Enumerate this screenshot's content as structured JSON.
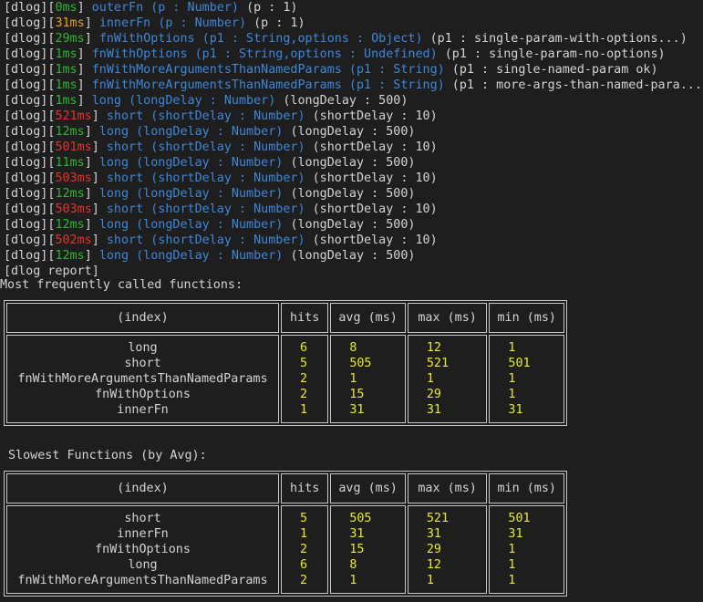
{
  "log_prefix": "[dlog]",
  "log_lines": [
    {
      "time": "0ms",
      "time_color": "green",
      "fn": "outerFn",
      "sig": "(p : Number)",
      "args": "(p : 1)"
    },
    {
      "time": "31ms",
      "time_color": "orange",
      "fn": "innerFn",
      "sig": "(p : Number)",
      "args": "(p : 1)"
    },
    {
      "time": "29ms",
      "time_color": "green",
      "fn": "fnWithOptions",
      "sig": "(p1 : String,options : Object)",
      "args": "(p1 : single-param-with-options...)"
    },
    {
      "time": "1ms",
      "time_color": "green",
      "fn": "fnWithOptions",
      "sig": "(p1 : String,options : Undefined)",
      "args": "(p1 : single-param-no-options)"
    },
    {
      "time": "1ms",
      "time_color": "green",
      "fn": "fnWithMoreArgumentsThanNamedParams",
      "sig": "(p1 : String)",
      "args": "(p1 : single-named-param ok)"
    },
    {
      "time": "1ms",
      "time_color": "green",
      "fn": "fnWithMoreArgumentsThanNamedParams",
      "sig": "(p1 : String)",
      "args": "(p1 : more-args-than-named-para...)"
    },
    {
      "time": "1ms",
      "time_color": "green",
      "fn": "long",
      "sig": "(longDelay : Number)",
      "args": "(longDelay : 500)"
    },
    {
      "time": "521ms",
      "time_color": "red",
      "fn": "short",
      "sig": "(shortDelay : Number)",
      "args": "(shortDelay : 10)"
    },
    {
      "time": "12ms",
      "time_color": "green",
      "fn": "long",
      "sig": "(longDelay : Number)",
      "args": "(longDelay : 500)"
    },
    {
      "time": "501ms",
      "time_color": "red",
      "fn": "short",
      "sig": "(shortDelay : Number)",
      "args": "(shortDelay : 10)"
    },
    {
      "time": "11ms",
      "time_color": "green",
      "fn": "long",
      "sig": "(longDelay : Number)",
      "args": "(longDelay : 500)"
    },
    {
      "time": "503ms",
      "time_color": "red",
      "fn": "short",
      "sig": "(shortDelay : Number)",
      "args": "(shortDelay : 10)"
    },
    {
      "time": "12ms",
      "time_color": "green",
      "fn": "long",
      "sig": "(longDelay : Number)",
      "args": "(longDelay : 500)"
    },
    {
      "time": "503ms",
      "time_color": "red",
      "fn": "short",
      "sig": "(shortDelay : Number)",
      "args": "(shortDelay : 10)"
    },
    {
      "time": "12ms",
      "time_color": "green",
      "fn": "long",
      "sig": "(longDelay : Number)",
      "args": "(longDelay : 500)"
    },
    {
      "time": "502ms",
      "time_color": "red",
      "fn": "short",
      "sig": "(shortDelay : Number)",
      "args": "(shortDelay : 10)"
    },
    {
      "time": "12ms",
      "time_color": "green",
      "fn": "long",
      "sig": "(longDelay : Number)",
      "args": "(longDelay : 500)"
    }
  ],
  "report_line": "[dlog report]",
  "colors": {
    "green": "#2fb52f",
    "orange": "#e8a21a",
    "red": "#e8322a",
    "blue": "#3e87d8",
    "number": "#e8e82c"
  },
  "table1": {
    "heading": "Most frequently called functions:",
    "headers": [
      "(index)",
      "hits",
      "avg (ms)",
      "max (ms)",
      "min (ms)"
    ],
    "rows": [
      [
        "long",
        "6",
        "8",
        "12",
        "1"
      ],
      [
        "short",
        "5",
        "505",
        "521",
        "501"
      ],
      [
        "fnWithMoreArgumentsThanNamedParams",
        "2",
        "1",
        "1",
        "1"
      ],
      [
        "fnWithOptions",
        "2",
        "15",
        "29",
        "1"
      ],
      [
        "innerFn",
        "1",
        "31",
        "31",
        "31"
      ]
    ]
  },
  "table2": {
    "heading": "Slowest Functions (by Avg):",
    "headers": [
      "(index)",
      "hits",
      "avg (ms)",
      "max (ms)",
      "min (ms)"
    ],
    "rows": [
      [
        "short",
        "5",
        "505",
        "521",
        "501"
      ],
      [
        "innerFn",
        "1",
        "31",
        "31",
        "31"
      ],
      [
        "fnWithOptions",
        "2",
        "15",
        "29",
        "1"
      ],
      [
        "long",
        "6",
        "8",
        "12",
        "1"
      ],
      [
        "fnWithMoreArgumentsThanNamedParams",
        "2",
        "1",
        "1",
        "1"
      ]
    ]
  }
}
